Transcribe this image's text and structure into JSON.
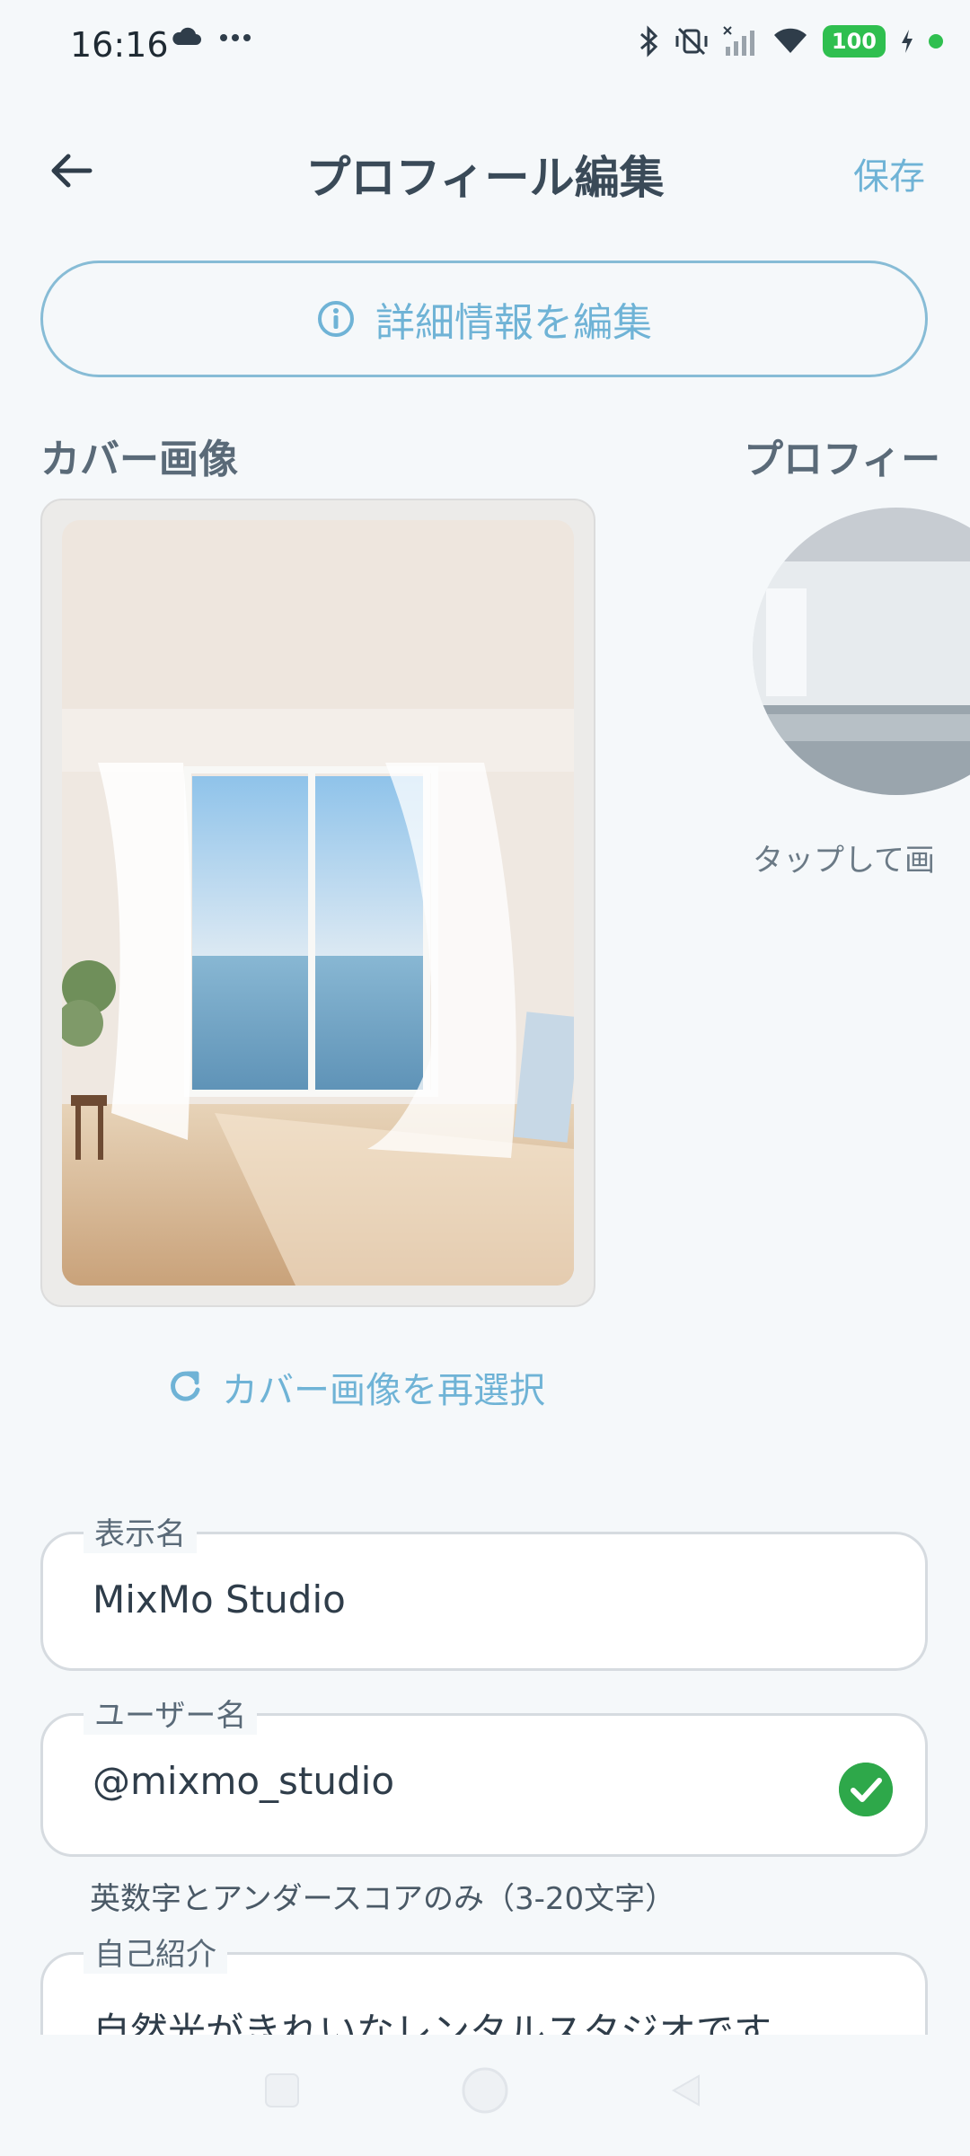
{
  "status_bar": {
    "time": "16:16",
    "battery": "100",
    "icons": [
      "cloud-icon",
      "more-icon",
      "bluetooth-icon",
      "vibrate-off-icon",
      "signal-icon",
      "wifi-icon",
      "battery-icon",
      "charging-icon"
    ]
  },
  "app_bar": {
    "title": "プロフィール編集",
    "save_label": "保存"
  },
  "details_button": {
    "label": "詳細情報を編集"
  },
  "cover": {
    "title": "カバー画像",
    "reselect_label": "カバー画像を再選択"
  },
  "profile_image": {
    "title": "プロフィー",
    "tap_hint": "タップして画"
  },
  "fields": {
    "display_name": {
      "label": "表示名",
      "value": "MixMo Studio"
    },
    "username": {
      "label": "ユーザー名",
      "value": "@mixmo_studio",
      "hint": "英数字とアンダースコアのみ（3-20文字）"
    },
    "bio": {
      "label": "自己紹介",
      "value": "自然光がきれいなレンタルスタジオです。"
    }
  },
  "colors": {
    "accent": "#6fb3d6",
    "success": "#2ea84a",
    "background": "#f5f8fa"
  }
}
